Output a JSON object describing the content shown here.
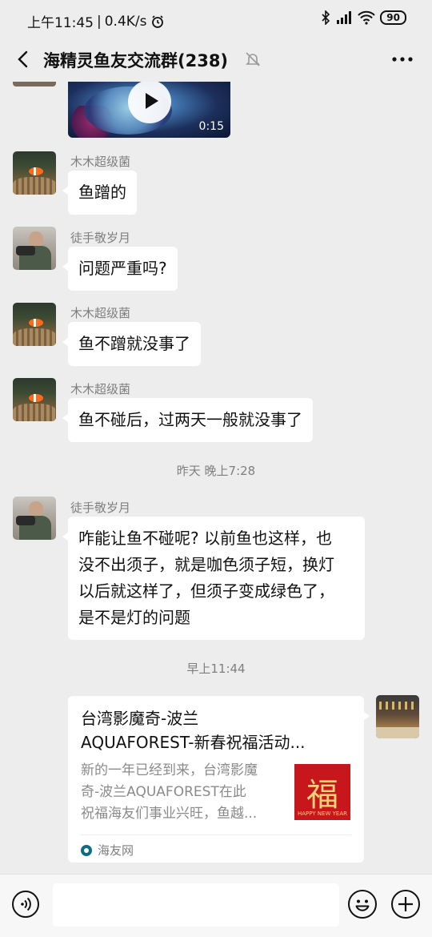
{
  "status_bar": {
    "time": "上午11:45",
    "speed": "0.4K/s",
    "battery": "90",
    "network_label": "HD"
  },
  "nav": {
    "title": "海精灵鱼友交流群(238)"
  },
  "video": {
    "duration": "0:15"
  },
  "messages": [
    {
      "sender": "木木超级菌",
      "text": "鱼蹭的"
    },
    {
      "sender": "徒手敬岁月",
      "text": "问题严重吗?"
    },
    {
      "sender": "木木超级菌",
      "text": "鱼不蹭就没事了"
    },
    {
      "sender": "木木超级菌",
      "text": "鱼不碰后，过两天一般就没事了"
    },
    {
      "sender": "徒手敬岁月",
      "lines": [
        "咋能让鱼不碰呢? 以前鱼也这样，也",
        "没不出须子，就是咖色须子短，换灯",
        "以后就这样了，但须子变成绿色了，",
        "是不是灯的问题"
      ]
    }
  ],
  "time_separators": [
    "昨天 晚上7:28",
    "早上11:44"
  ],
  "link_card": {
    "title_lines": [
      "台湾影魔奇-波兰",
      "AQUAFOREST-新春祝福活动..."
    ],
    "desc_lines": [
      "新的一年已经到来，台湾影魔",
      "奇-波兰AQUAFOREST在此",
      "祝福海友们事业兴旺，鱼越..."
    ],
    "thumb_char": "福",
    "thumb_tag": "HAPPY NEW YEAR",
    "source": "海友网"
  },
  "colors": {
    "background": "#ededed",
    "bubble": "#ffffff",
    "meta_text": "#7f7f7f"
  }
}
